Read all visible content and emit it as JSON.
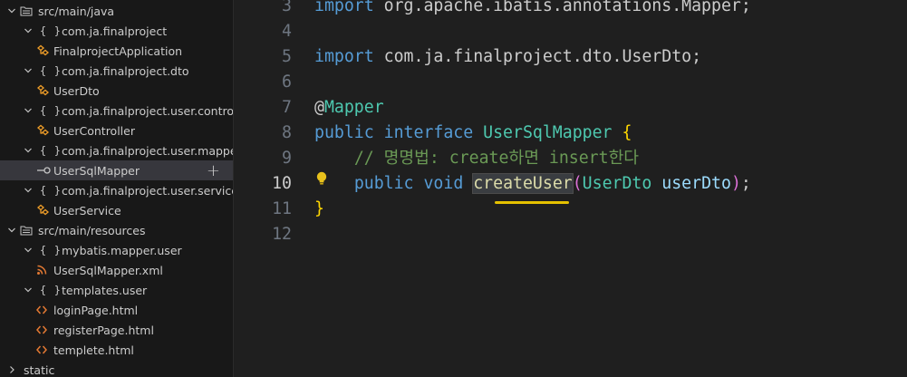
{
  "explorer": {
    "items": [
      {
        "label": "src/main/java",
        "kind": "folder"
      },
      {
        "label": "com.ja.finalproject",
        "kind": "package"
      },
      {
        "label": "FinalprojectApplication",
        "kind": "class"
      },
      {
        "label": "com.ja.finalproject.dto",
        "kind": "package"
      },
      {
        "label": "UserDto",
        "kind": "class"
      },
      {
        "label": "com.ja.finalproject.user.controller",
        "kind": "package"
      },
      {
        "label": "UserController",
        "kind": "class"
      },
      {
        "label": "com.ja.finalproject.user.mapper",
        "kind": "package"
      },
      {
        "label": "UserSqlMapper",
        "kind": "interface"
      },
      {
        "label": "com.ja.finalproject.user.service",
        "kind": "package"
      },
      {
        "label": "UserService",
        "kind": "class"
      },
      {
        "label": "src/main/resources",
        "kind": "folder"
      },
      {
        "label": "mybatis.mapper.user",
        "kind": "package"
      },
      {
        "label": "UserSqlMapper.xml",
        "kind": "xml"
      },
      {
        "label": "templates.user",
        "kind": "package"
      },
      {
        "label": "loginPage.html",
        "kind": "html"
      },
      {
        "label": "registerPage.html",
        "kind": "html"
      },
      {
        "label": "templete.html",
        "kind": "html"
      },
      {
        "label": "static",
        "kind": "folder-collapsed"
      }
    ],
    "package_glyph": "{ }",
    "new_file_glyph": "+"
  },
  "editor": {
    "active_line": "10",
    "lines": [
      {
        "num": "3",
        "tokens": [
          {
            "t": "import ",
            "c": "kw"
          },
          {
            "t": "org.apache.ibatis.annotations.Mapper;",
            "c": ""
          }
        ]
      },
      {
        "num": "4",
        "tokens": []
      },
      {
        "num": "5",
        "tokens": [
          {
            "t": "import ",
            "c": "kw"
          },
          {
            "t": "com.ja.finalproject.dto.UserDto;",
            "c": ""
          }
        ]
      },
      {
        "num": "6",
        "tokens": []
      },
      {
        "num": "7",
        "tokens": [
          {
            "t": "@",
            "c": ""
          },
          {
            "t": "Mapper",
            "c": "cls"
          }
        ]
      },
      {
        "num": "8",
        "tokens": [
          {
            "t": "public ",
            "c": "kw"
          },
          {
            "t": "interface ",
            "c": "kw"
          },
          {
            "t": "UserSqlMapper ",
            "c": "cls"
          },
          {
            "t": "{",
            "c": "br1"
          }
        ]
      },
      {
        "num": "9",
        "tokens": [
          {
            "t": "    ",
            "c": ""
          },
          {
            "t": "// 명명법: create하면 insert한다",
            "c": "cmt"
          }
        ]
      },
      {
        "num": "10",
        "tokens": [
          {
            "t": "    ",
            "c": ""
          },
          {
            "t": "public ",
            "c": "kw"
          },
          {
            "t": "void ",
            "c": "kw"
          },
          {
            "t": "createUser",
            "c": "fn hl"
          },
          {
            "t": "(",
            "c": "br2"
          },
          {
            "t": "UserDto ",
            "c": "cls"
          },
          {
            "t": "userDto",
            "c": "var"
          },
          {
            "t": ")",
            "c": "br2"
          },
          {
            "t": ";",
            "c": ""
          }
        ]
      },
      {
        "num": "11",
        "tokens": [
          {
            "t": "}",
            "c": "br1"
          }
        ]
      },
      {
        "num": "12",
        "tokens": []
      }
    ]
  }
}
